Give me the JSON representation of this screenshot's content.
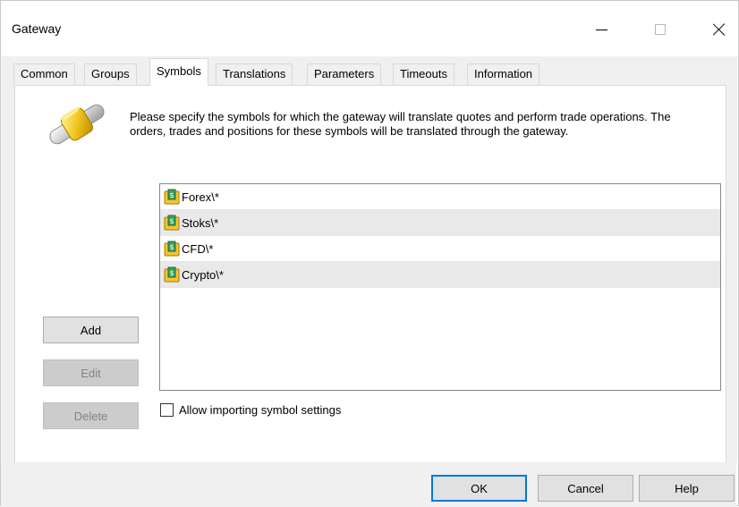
{
  "window": {
    "title": "Gateway"
  },
  "tabs": [
    {
      "label": "Common",
      "active": false
    },
    {
      "label": "Groups",
      "active": false
    },
    {
      "label": "Symbols",
      "active": true
    },
    {
      "label": "Translations",
      "active": false
    },
    {
      "label": "Parameters",
      "active": false
    },
    {
      "label": "Timeouts",
      "active": false
    },
    {
      "label": "Information",
      "active": false
    }
  ],
  "description": "Please specify the symbols for which the gateway will translate quotes and perform trade operations. The orders, trades and positions for these symbols will be translated through the gateway.",
  "symbols": [
    {
      "label": "Forex\\*",
      "icon": "symbol-folder-icon"
    },
    {
      "label": "Stoks\\*",
      "icon": "symbol-folder-icon"
    },
    {
      "label": "CFD\\*",
      "icon": "symbol-folder-icon"
    },
    {
      "label": "Crypto\\*",
      "icon": "symbol-folder-icon"
    }
  ],
  "side_buttons": {
    "add": "Add",
    "edit": "Edit",
    "delete": "Delete"
  },
  "checkbox": {
    "label": "Allow importing symbol settings",
    "checked": false
  },
  "dialog_buttons": {
    "ok": "OK",
    "cancel": "Cancel",
    "help": "Help"
  },
  "colors": {
    "accent": "#0078d7",
    "list_alt_row": "#e9e9e9",
    "dialog_bg": "#f0f0f0"
  }
}
